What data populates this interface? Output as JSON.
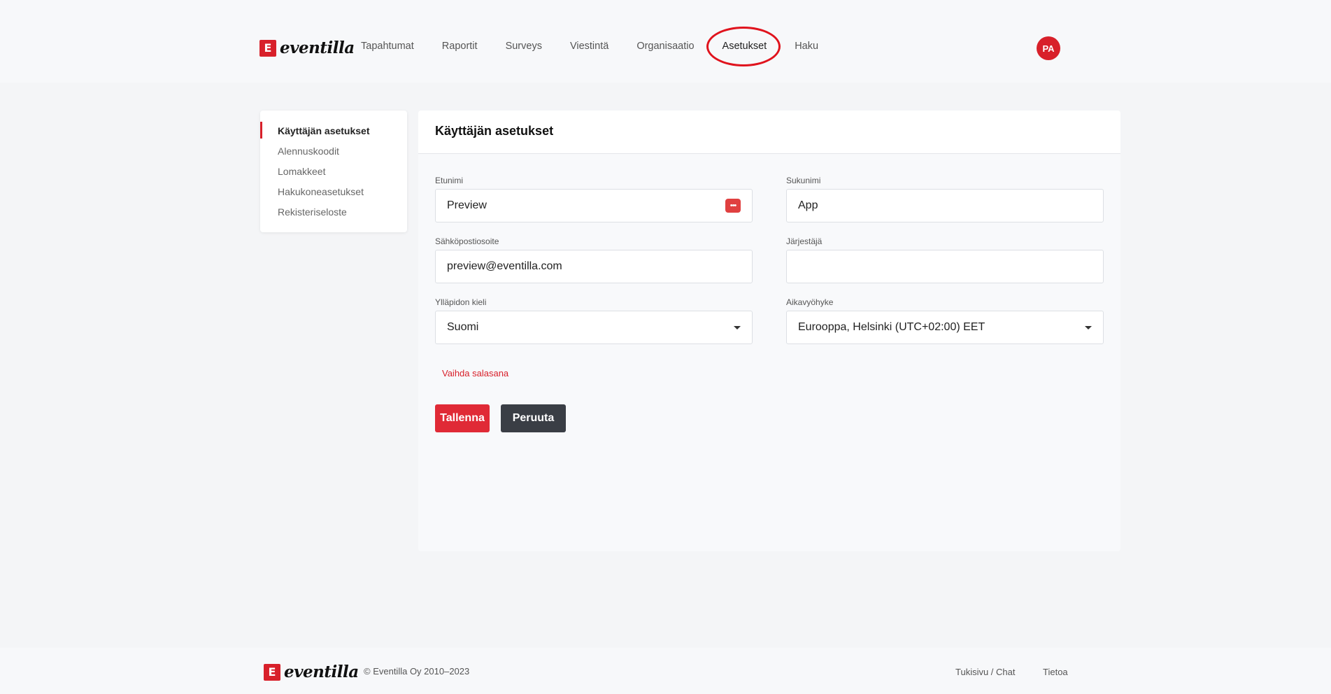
{
  "brand": {
    "name": "eventilla",
    "mark": "E"
  },
  "nav": {
    "items": [
      {
        "label": "Tapahtumat"
      },
      {
        "label": "Raportit"
      },
      {
        "label": "Surveys"
      },
      {
        "label": "Viestintä"
      },
      {
        "label": "Organisaatio"
      },
      {
        "label": "Asetukset",
        "active": true
      },
      {
        "label": "Haku"
      }
    ]
  },
  "user": {
    "initials": "PA"
  },
  "sidebar": {
    "items": [
      {
        "label": "Käyttäjän asetukset",
        "active": true
      },
      {
        "label": "Alennuskoodit"
      },
      {
        "label": "Lomakkeet"
      },
      {
        "label": "Hakukoneasetukset"
      },
      {
        "label": "Rekisteriseloste"
      }
    ]
  },
  "form": {
    "title": "Käyttäjän asetukset",
    "first_name": {
      "label": "Etunimi",
      "value": "Preview"
    },
    "last_name": {
      "label": "Sukunimi",
      "value": "App"
    },
    "email": {
      "label": "Sähköpostiosoite",
      "value": "preview@eventilla.com"
    },
    "organizer": {
      "label": "Järjestäjä",
      "value": ""
    },
    "language": {
      "label": "Ylläpidon kieli",
      "value": "Suomi"
    },
    "timezone": {
      "label": "Aikavyöhyke",
      "value": "Eurooppa, Helsinki (UTC+02:00) EET"
    },
    "change_password": "Vaihda salasana",
    "save_label": "Tallenna",
    "cancel_label": "Peruuta"
  },
  "footer": {
    "copyright": "© Eventilla Oy 2010–2023",
    "support": "Tukisivu / Chat",
    "about": "Tietoa"
  },
  "colors": {
    "accent": "#d8202a",
    "dark_button": "#3a3e45"
  }
}
